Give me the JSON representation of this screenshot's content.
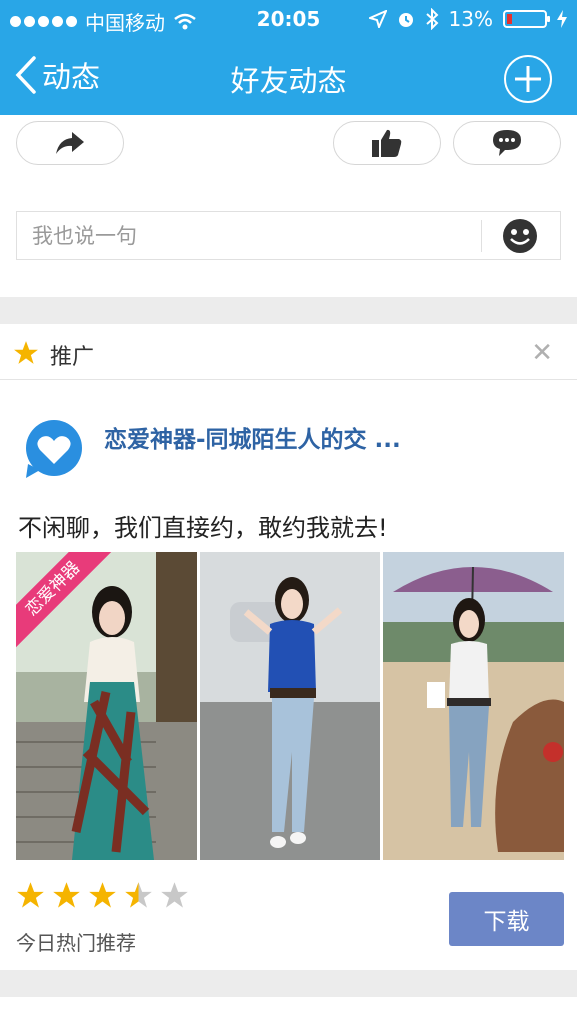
{
  "status_bar": {
    "carrier": "中国移动",
    "time": "20:05",
    "battery": "13%"
  },
  "nav": {
    "back_label": "动态",
    "title": "好友动态"
  },
  "comment": {
    "placeholder": "我也说一句"
  },
  "promo": {
    "label": "推广",
    "app_name": "恋爱神器-同城陌生人的交 ...",
    "slogan": "不闲聊，我们直接约，敢约我就去!",
    "ribbon_text": "恋爱神器",
    "rating": 3.5,
    "rating_max": 5,
    "hot_text": "今日热门推荐",
    "download_label": "下载"
  },
  "colors": {
    "nav_bg": "#29a6e7",
    "star": "#f5b400",
    "download_bg": "#6c86c7",
    "app_name": "#2e63a4"
  }
}
